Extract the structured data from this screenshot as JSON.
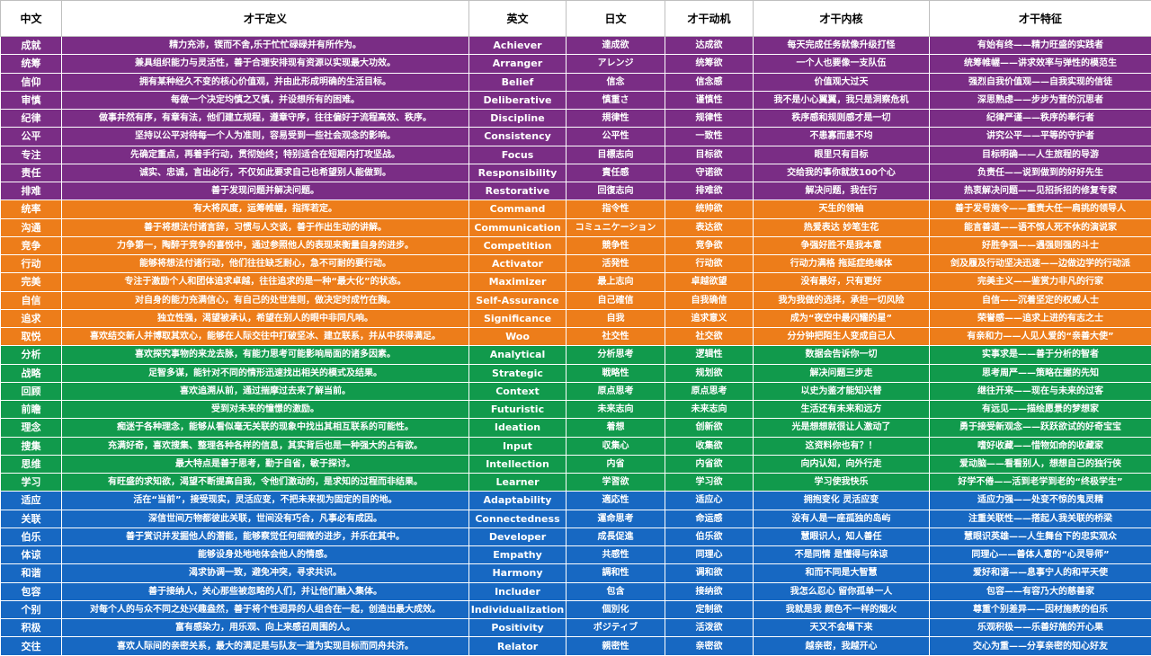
{
  "headers": [
    "中文",
    "才干定义",
    "英文",
    "日文",
    "才干动机",
    "才干内核",
    "才干特征"
  ],
  "colors": {
    "purple": "#7a2d85",
    "orange": "#ed7d1a",
    "green": "#119a4c",
    "blue": "#1768c2"
  },
  "rows": [
    {
      "group": "purple",
      "cn": "成就",
      "def": "精力充沛，锲而不舍,乐于忙忙碌碌并有所作为。",
      "en": "Achiever",
      "jp": "達成欲",
      "motive": "达成欲",
      "core": "每天完成任务就像升级打怪",
      "trait": "有始有终——精力旺盛的实践者"
    },
    {
      "group": "purple",
      "cn": "统筹",
      "def": "兼具组织能力与灵活性，善于合理安排现有资源以实现最大功效。",
      "en": "Arranger",
      "jp": "アレンジ",
      "motive": "统筹欲",
      "core": "一个人也要像一支队伍",
      "trait": "统筹帷幄——讲求效率与弹性的模范生"
    },
    {
      "group": "purple",
      "cn": "信仰",
      "def": "拥有某种经久不变的核心价值观，并由此形成明确的生活目标。",
      "en": "Belief",
      "jp": "信念",
      "motive": "信念感",
      "core": "价值观大过天",
      "trait": "强烈自我价值观——自我实现的信徒"
    },
    {
      "group": "purple",
      "cn": "审慎",
      "def": "每做一个决定均慎之又慎，并设想所有的困难。",
      "en": "Deliberative",
      "jp": "慎重さ",
      "motive": "谨慎性",
      "core": "我不是小心翼翼，我只是洞察危机",
      "trait": "深思熟虑——步步为营的沉思者"
    },
    {
      "group": "purple",
      "cn": "纪律",
      "def": "做事井然有序，有章有法，他们建立规程，遵章守序，往往偏好于流程高效、秩序。",
      "en": "Discipline",
      "jp": "規律性",
      "motive": "规律性",
      "core": "秩序感和规则感才是一切",
      "trait": "纪律严谨——秩序的奉行者"
    },
    {
      "group": "purple",
      "cn": "公平",
      "def": "坚持以公平对待每一个人为准则，容易受到一些社会观念的影响。",
      "en": "Consistency",
      "jp": "公平性",
      "motive": "一致性",
      "core": "不患寡而患不均",
      "trait": "讲究公平——平等的守护者"
    },
    {
      "group": "purple",
      "cn": "专注",
      "def": "先确定重点，再着手行动，贯彻始终；特别适合在短期内打攻坚战。",
      "en": "Focus",
      "jp": "目標志向",
      "motive": "目标欲",
      "core": "眼里只有目标",
      "trait": "目标明确——人生旅程的导游"
    },
    {
      "group": "purple",
      "cn": "责任",
      "def": "诚实、忠诚，言出必行，不仅如此要求自己也希望别人能做到。",
      "en": "Responsibility",
      "jp": "責任感",
      "motive": "守诺欲",
      "core": "交给我的事你就放100个心",
      "trait": "负责任——说到做到的好好先生"
    },
    {
      "group": "purple",
      "cn": "排难",
      "def": "善于发现问题并解决问题。",
      "en": "Restorative",
      "jp": "回復志向",
      "motive": "排难欲",
      "core": "解决问题，我在行",
      "trait": "热衷解决问题——见招拆招的修复专家"
    },
    {
      "group": "orange",
      "cn": "统率",
      "def": "有大将风度，运筹帷幄，指挥若定。",
      "en": "Command",
      "jp": "指令性",
      "motive": "统帅欲",
      "core": "天生的领袖",
      "trait": "善于发号施令——重责大任一肩挑的领导人"
    },
    {
      "group": "orange",
      "cn": "沟通",
      "def": "善于将想法付诸言辞，习惯与人交谈，善于作出生动的讲解。",
      "en": "Communication",
      "jp": "コミュニケーション",
      "motive": "表达欲",
      "core": "热爱表达 妙笔生花",
      "trait": "能言善道——语不惊人死不休的演说家"
    },
    {
      "group": "orange",
      "cn": "竞争",
      "def": "力争第一，陶醉于竞争的喜悦中，通过参照他人的表现来衡量自身的进步。",
      "en": "Competition",
      "jp": "競争性",
      "motive": "竞争欲",
      "core": "争强好胜不是我本意",
      "trait": "好胜争强——遇强则强的斗士"
    },
    {
      "group": "orange",
      "cn": "行动",
      "def": "能够将想法付诸行动，他们往往缺乏耐心，急不可耐的要行动。",
      "en": "Activator",
      "jp": "活発性",
      "motive": "行动欲",
      "core": "行动力满格 拖延症绝缘体",
      "trait": "剑及履及行动坚决迅速——边做边学的行动派"
    },
    {
      "group": "orange",
      "cn": "完美",
      "def": "专注于激励个人和团体追求卓越，往往追求的是一种“最大化”的状态。",
      "en": "Maximizer",
      "jp": "最上志向",
      "motive": "卓越欲望",
      "core": "没有最好，只有更好",
      "trait": "完美主义——鉴赏力非凡的行家"
    },
    {
      "group": "orange",
      "cn": "自信",
      "def": "对自身的能力充满信心，有自己的处世准则，做决定时成竹在胸。",
      "en": "Self-Assurance",
      "jp": "自己確信",
      "motive": "自我确信",
      "core": "我为我做的选择，承担一切风险",
      "trait": "自信——沉着坚定的权威人士"
    },
    {
      "group": "orange",
      "cn": "追求",
      "def": "独立性强，渴望被承认，希望在别人的眼中非同凡响。",
      "en": "Significance",
      "jp": "自我",
      "motive": "追求意义",
      "core": "成为“夜空中最闪耀的星”",
      "trait": "荣誉感——追求上进的有志之士"
    },
    {
      "group": "orange",
      "cn": "取悦",
      "def": "喜欢结交新人并博取其欢心，能够在人际交往中打破坚冰、建立联系，并从中获得满足。",
      "en": "Woo",
      "jp": "社交性",
      "motive": "社交欲",
      "core": "分分钟把陌生人变成自己人",
      "trait": "有亲和力——人见人爱的“亲善大使”"
    },
    {
      "group": "green",
      "cn": "分析",
      "def": "喜欢探究事物的来龙去脉，有能力思考可能影响局面的诸多因素。",
      "en": "Analytical",
      "jp": "分析思考",
      "motive": "逻辑性",
      "core": "数据会告诉你一切",
      "trait": "实事求是——善于分析的智者"
    },
    {
      "group": "green",
      "cn": "战略",
      "def": "足智多谋，能针对不同的情形迅速找出相关的模式及结果。",
      "en": "Strategic",
      "jp": "戦略性",
      "motive": "规划欲",
      "core": "解决问题三步走",
      "trait": "思考周严——策略在握的先知"
    },
    {
      "group": "green",
      "cn": "回顾",
      "def": "喜欢追溯从前，通过揣摩过去来了解当前。",
      "en": "Context",
      "jp": "原点思考",
      "motive": "原点思考",
      "core": "以史为鉴才能知兴替",
      "trait": "继往开来——现在与未来的过客"
    },
    {
      "group": "green",
      "cn": "前瞻",
      "def": "受到对未来的憧憬的激励。",
      "en": "Futuristic",
      "jp": "未来志向",
      "motive": "未来志向",
      "core": "生活还有未来和远方",
      "trait": "有远见——描绘愿景的梦想家"
    },
    {
      "group": "green",
      "cn": "理念",
      "def": "痴迷于各种理念，能够从看似毫无关联的现象中找出其相互联系的可能性。",
      "en": "Ideation",
      "jp": "着想",
      "motive": "创新欲",
      "core": "光是想想就很让人激动了",
      "trait": "勇于接受新观念——跃跃欲试的好奇宝宝"
    },
    {
      "group": "green",
      "cn": "搜集",
      "def": "充满好奇，喜欢搜集、整理各种各样的信息，其实背后也是一种强大的占有欲。",
      "en": "Input",
      "jp": "収集心",
      "motive": "收集欲",
      "core": "这资料你也有？！",
      "trait": "嗜好收藏——惜物如命的收藏家"
    },
    {
      "group": "green",
      "cn": "思维",
      "def": "最大特点是善于思考，勤于自省，敏于探讨。",
      "en": "Intellection",
      "jp": "内省",
      "motive": "内省欲",
      "core": "向内认知，向外行走",
      "trait": "爱动脑——看看别人，想想自己的独行侠"
    },
    {
      "group": "green",
      "cn": "学习",
      "def": "有旺盛的求知欲，渴望不断提高自我，令他们激动的，是求知的过程而非结果。",
      "en": "Learner",
      "jp": "学習欲",
      "motive": "学习欲",
      "core": "学习使我快乐",
      "trait": "好学不倦——活到老学到老的“终极学生”"
    },
    {
      "group": "blue",
      "cn": "适应",
      "def": "活在“当前”，接受现实，灵活应变，不把未来视为固定的目的地。",
      "en": "Adaptability",
      "jp": "適応性",
      "motive": "适应心",
      "core": "拥抱变化 灵活应变",
      "trait": "适应力强——处变不惊的鬼灵精"
    },
    {
      "group": "blue",
      "cn": "关联",
      "def": "深信世间万物都彼此关联，世间没有巧合，凡事必有成因。",
      "en": "Connectedness",
      "jp": "運命思考",
      "motive": "命运感",
      "core": "没有人是一座孤独的岛屿",
      "trait": "注重关联性——搭起人我关联的桥梁"
    },
    {
      "group": "blue",
      "cn": "伯乐",
      "def": "善于赏识并发掘他人的潜能，能够察觉任何细微的进步，并乐在其中。",
      "en": "Developer",
      "jp": "成長促進",
      "motive": "伯乐欲",
      "core": "慧眼识人，知人善任",
      "trait": "慧眼识英雄——人生舞台下的忠实观众"
    },
    {
      "group": "blue",
      "cn": "体谅",
      "def": "能够设身处地地体会他人的情感。",
      "en": "Empathy",
      "jp": "共感性",
      "motive": "同理心",
      "core": "不是同情 是懂得与体谅",
      "trait": "同理心——善体人意的“心灵导师”"
    },
    {
      "group": "blue",
      "cn": "和谐",
      "def": "渴求协调一致，避免冲突，寻求共识。",
      "en": "Harmony",
      "jp": "調和性",
      "motive": "调和欲",
      "core": "和而不同是大智慧",
      "trait": "爱好和谐——息事宁人的和平天使"
    },
    {
      "group": "blue",
      "cn": "包容",
      "def": "善于接纳人，关心那些被忽略的人们，并让他们融入集体。",
      "en": "Includer",
      "jp": "包含",
      "motive": "接纳欲",
      "core": "我怎么忍心 留你孤单一人",
      "trait": "包容——有容乃大的慈善家"
    },
    {
      "group": "blue",
      "cn": "个别",
      "def": "对每个人的与众不同之处兴趣盎然，善于将个性迥异的人组合在一起，创造出最大成效。",
      "en": "Individualization",
      "jp": "個別化",
      "motive": "定制欲",
      "core": "我就是我 颜色不一样的烟火",
      "trait": "尊重个别差异——因材施教的伯乐"
    },
    {
      "group": "blue",
      "cn": "积极",
      "def": "富有感染力，用乐观、向上来感召周围的人。",
      "en": "Positivity",
      "jp": "ポジティブ",
      "motive": "活泼欲",
      "core": "天又不会塌下来",
      "trait": "乐观积极——乐善好施的开心果"
    },
    {
      "group": "blue",
      "cn": "交往",
      "def": "喜欢人际间的亲密关系，最大的满足是与队友一道为实现目标而同舟共济。",
      "en": "Relator",
      "jp": "親密性",
      "motive": "亲密欲",
      "core": "越亲密，我越开心",
      "trait": "交心为重——分享亲密的知心好友"
    }
  ]
}
